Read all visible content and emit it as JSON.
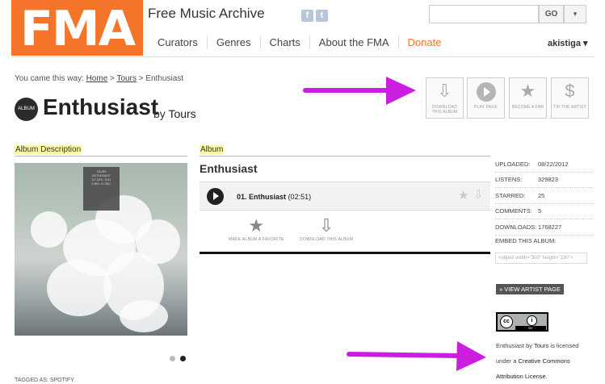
{
  "header": {
    "logo_text": "FMA",
    "site_title": "Free Music Archive",
    "social": [
      "f",
      "t"
    ],
    "search": {
      "value": "",
      "button": "GO",
      "dropdown": "▾"
    },
    "nav": [
      "Curators",
      "Genres",
      "Charts",
      "About the FMA",
      "Donate"
    ],
    "user": "akistiga ▾"
  },
  "breadcrumb": {
    "prefix": "You came this way:",
    "items": [
      "Home",
      "Tours",
      "Enthusiast"
    ],
    "sep": ">"
  },
  "album": {
    "badge": "ALBUM",
    "title": "Enthusiast",
    "by": "by",
    "artist": "Tours",
    "description_label": "Album Description",
    "section_label": "Album",
    "name": "Enthusiast",
    "cover_text": [
      "TOURS",
      "ENTHUSIAST",
      "CC DEC. 2011",
      "3 MIN. 11 SEC."
    ]
  },
  "actions": [
    {
      "icon": "download-icon",
      "glyph": "⇩",
      "label": "DOWNLOAD THIS ALBUM"
    },
    {
      "icon": "play-icon",
      "glyph": "",
      "label": "PLAY PAGE"
    },
    {
      "icon": "star-icon",
      "glyph": "★",
      "label": "BECOME A FAN"
    },
    {
      "icon": "dollar-icon",
      "glyph": "$",
      "label": "TIP THE ARTIST"
    }
  ],
  "track": {
    "number": "01.",
    "title": "Enthusiast",
    "duration": "(02:51)"
  },
  "mid_actions": [
    {
      "glyph": "★",
      "label": "MAKE ALBUM A FAVORITE"
    },
    {
      "glyph": "⇩",
      "label": "DOWNLOAD THIS ALBUM"
    }
  ],
  "meta": [
    {
      "key": "UPLOADED:",
      "value": "08/22/2012"
    },
    {
      "key": "LISTENS:",
      "value": "329823"
    },
    {
      "key": "STARRED:",
      "value": "25"
    },
    {
      "key": "COMMENTS:",
      "value": "5"
    },
    {
      "key": "DOWNLOADS:",
      "value": "1768227"
    }
  ],
  "embed": {
    "label": "EMBED THIS ALBUM:",
    "value": "<object width=\"300\" height=\"130\">"
  },
  "view_artist": "» VIEW ARTIST PAGE",
  "cc": {
    "c": "cc",
    "i": "i",
    "by": "BY"
  },
  "license": {
    "pre": "Enthusiast by ",
    "artist": "Tours",
    "mid": " is licensed under a ",
    "link": "Creative Commons Attribution License",
    "end": "."
  },
  "tagged": "TAGGED AS: SPOTIFY",
  "colors": {
    "brand": "#f4742a",
    "annotation_arrow": "#cc1ee0",
    "highlight": "#fdf9a6"
  }
}
